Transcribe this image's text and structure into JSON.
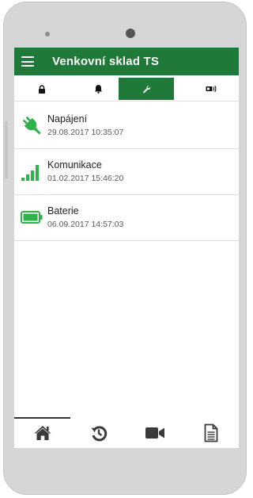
{
  "app": {
    "title": "Venkovní sklad TS",
    "accent_color": "#1f7a3a",
    "indicator_color": "#2db34a"
  },
  "tabs": [
    {
      "icon": "lock-icon",
      "active": false
    },
    {
      "icon": "bell-icon",
      "active": false
    },
    {
      "icon": "wrench-icon",
      "active": true
    },
    {
      "icon": "device-signal-icon",
      "active": false
    }
  ],
  "items": [
    {
      "label": "Napájení",
      "timestamp": "29.08.2017 10:35:07",
      "icon": "power-plug-icon"
    },
    {
      "label": "Komunikace",
      "timestamp": "01.02.2017 15:46:20",
      "icon": "signal-bars-icon"
    },
    {
      "label": "Baterie",
      "timestamp": "06.09.2017 14:57:03",
      "icon": "battery-full-icon"
    }
  ],
  "bottom_nav": [
    {
      "icon": "home-icon",
      "active": true
    },
    {
      "icon": "history-icon",
      "active": false
    },
    {
      "icon": "video-camera-icon",
      "active": false
    },
    {
      "icon": "document-icon",
      "active": false
    }
  ]
}
